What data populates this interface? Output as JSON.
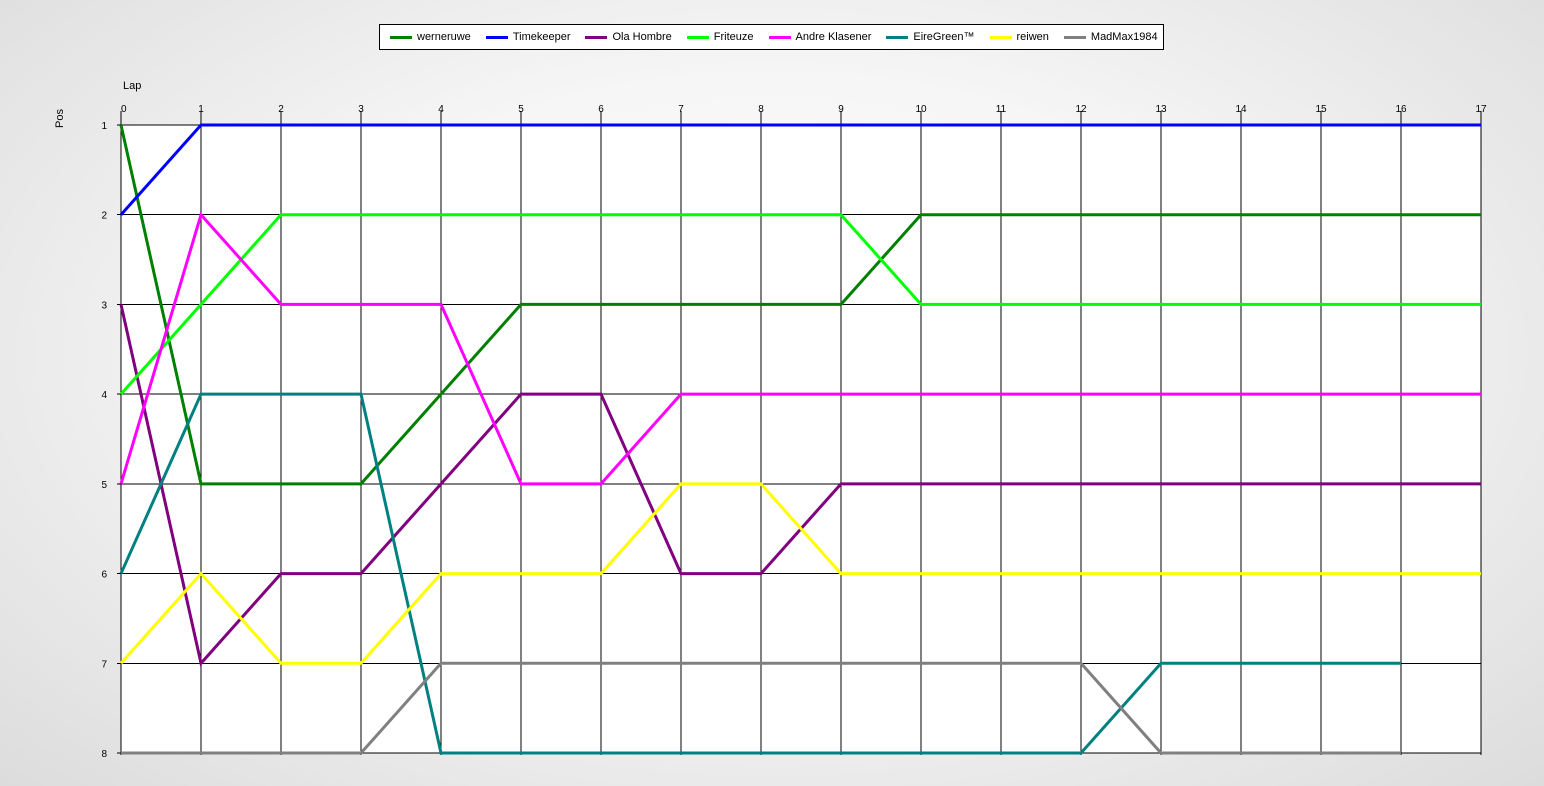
{
  "chart_data": {
    "type": "line",
    "xlabel": "Lap",
    "ylabel": "Pos",
    "xlim": [
      0,
      17
    ],
    "ylim": [
      1,
      8
    ],
    "y_inverted": true,
    "grid": true,
    "legend_position": "top-center",
    "x_ticks": [
      "0",
      "1",
      "2",
      "3",
      "4",
      "5",
      "6",
      "7",
      "8",
      "9",
      "10",
      "11",
      "12",
      "13",
      "14",
      "15",
      "16",
      "17"
    ],
    "y_ticks": [
      "1",
      "2",
      "3",
      "4",
      "5",
      "6",
      "7",
      "8"
    ],
    "series": [
      {
        "name": "werneruwe",
        "color": "#008000",
        "x": [
          0,
          1,
          2,
          3,
          4,
          5,
          6,
          7,
          8,
          9,
          10,
          11,
          12,
          13,
          14,
          15,
          16,
          17
        ],
        "values": [
          1,
          5,
          5,
          5,
          4,
          3,
          3,
          3,
          3,
          3,
          2,
          2,
          2,
          2,
          2,
          2,
          2,
          2
        ]
      },
      {
        "name": "Timekeeper",
        "color": "#0000ff",
        "x": [
          0,
          1,
          2,
          3,
          4,
          5,
          6,
          7,
          8,
          9,
          10,
          11,
          12,
          13,
          14,
          15,
          16,
          17
        ],
        "values": [
          2,
          1,
          1,
          1,
          1,
          1,
          1,
          1,
          1,
          1,
          1,
          1,
          1,
          1,
          1,
          1,
          1,
          1
        ]
      },
      {
        "name": "Ola Hombre",
        "color": "#800080",
        "x": [
          0,
          1,
          2,
          3,
          4,
          5,
          6,
          7,
          8,
          9,
          10,
          11,
          12,
          13,
          14,
          15,
          16,
          17
        ],
        "values": [
          3,
          7,
          6,
          6,
          5,
          4,
          4,
          6,
          6,
          5,
          5,
          5,
          5,
          5,
          5,
          5,
          5,
          5
        ]
      },
      {
        "name": "Friteuze",
        "color": "#00ff00",
        "x": [
          0,
          1,
          2,
          3,
          4,
          5,
          6,
          7,
          8,
          9,
          10,
          11,
          12,
          13,
          14,
          15,
          16,
          17
        ],
        "values": [
          4,
          3,
          2,
          2,
          2,
          2,
          2,
          2,
          2,
          2,
          3,
          3,
          3,
          3,
          3,
          3,
          3,
          3
        ]
      },
      {
        "name": "Andre Klasener",
        "color": "#ff00ff",
        "x": [
          0,
          1,
          2,
          3,
          4,
          5,
          6,
          7,
          8,
          9,
          10,
          11,
          12,
          13,
          14,
          15,
          16,
          17
        ],
        "values": [
          5,
          2,
          3,
          3,
          3,
          5,
          5,
          4,
          4,
          4,
          4,
          4,
          4,
          4,
          4,
          4,
          4,
          4
        ]
      },
      {
        "name": "EireGreen™",
        "color": "#008080",
        "x": [
          0,
          1,
          2,
          3,
          4,
          5,
          6,
          7,
          8,
          9,
          10,
          11,
          12,
          13,
          14,
          15,
          16
        ],
        "values": [
          6,
          4,
          4,
          4,
          8,
          8,
          8,
          8,
          8,
          8,
          8,
          8,
          8,
          7,
          7,
          7,
          7
        ]
      },
      {
        "name": "reiwen",
        "color": "#ffff00",
        "x": [
          0,
          1,
          2,
          3,
          4,
          5,
          6,
          7,
          8,
          9,
          10,
          11,
          12,
          13,
          14,
          15,
          16,
          17
        ],
        "values": [
          7,
          6,
          7,
          7,
          6,
          6,
          6,
          5,
          5,
          6,
          6,
          6,
          6,
          6,
          6,
          6,
          6,
          6
        ]
      },
      {
        "name": "MadMax1984",
        "color": "#808080",
        "x": [
          0,
          1,
          2,
          3,
          4,
          5,
          6,
          7,
          8,
          9,
          10,
          11,
          12,
          13,
          14,
          15,
          16
        ],
        "values": [
          8,
          8,
          8,
          8,
          7,
          7,
          7,
          7,
          7,
          7,
          7,
          7,
          7,
          8,
          8,
          8,
          8
        ]
      }
    ]
  }
}
